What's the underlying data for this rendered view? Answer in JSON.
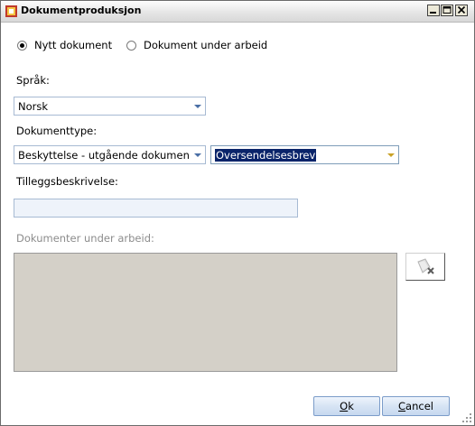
{
  "window": {
    "title": "Dokumentproduksjon",
    "icon": "app-icon",
    "controls": [
      "minimize-icon",
      "maximize-icon",
      "close-icon"
    ]
  },
  "doc_mode": {
    "options": [
      {
        "label": "Nytt dokument",
        "selected": true
      },
      {
        "label": "Dokument under arbeid",
        "selected": false
      }
    ]
  },
  "language": {
    "label": "Språk:",
    "value": "Norsk"
  },
  "doc_type": {
    "label": "Dokumenttype:",
    "category_value": "Beskyttelse - utgående dokumen",
    "template_value": "Oversendelsesbrev"
  },
  "extra_description": {
    "label": "Tilleggsbeskrivelse:",
    "value": ""
  },
  "documents_in_progress": {
    "label": "Dokumenter under arbeid:",
    "items": []
  },
  "buttons": {
    "ok": {
      "mnemonic": "O",
      "rest": "k"
    },
    "cancel": {
      "mnemonic": "C",
      "rest": "ancel"
    }
  },
  "colors": {
    "field_border": "#a7bad3",
    "selection": "#0a246a",
    "list_background": "#d4d0c8",
    "button_border": "#7b9cc9"
  }
}
